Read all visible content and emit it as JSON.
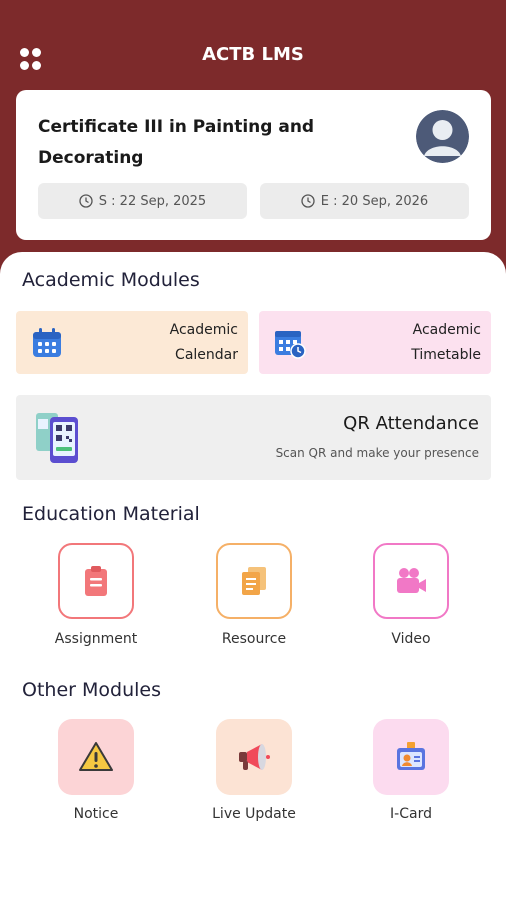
{
  "app": {
    "title": "ACTB LMS"
  },
  "course": {
    "title": "Certificate III in Painting and Decorating",
    "start_date": "S : 22 Sep, 2025",
    "end_date": "E : 20 Sep, 2026"
  },
  "academic_modules": {
    "title": "Academic Modules",
    "calendar_label": "Academic Calendar",
    "timetable_label": "Academic Timetable",
    "qr_title": "QR Attendance",
    "qr_subtitle": "Scan QR and make your presence"
  },
  "education_material": {
    "title": "Education Material",
    "items": [
      {
        "label": "Assignment",
        "icon": "clipboard-icon",
        "color": "#f2777a"
      },
      {
        "label": "Resource",
        "icon": "documents-icon",
        "color": "#f5b067"
      },
      {
        "label": "Video",
        "icon": "video-camera-icon",
        "color": "#f178c6"
      }
    ]
  },
  "other_modules": {
    "title": "Other Modules",
    "items": [
      {
        "label": "Notice",
        "icon": "warning-icon"
      },
      {
        "label": "Live Update",
        "icon": "megaphone-icon"
      },
      {
        "label": "I-Card",
        "icon": "id-card-icon"
      }
    ]
  },
  "colors": {
    "header": "#7d2a2b",
    "calendar_bg": "#fce9d6",
    "timetable_bg": "#fce1ef",
    "qr_bg": "#efefef"
  }
}
